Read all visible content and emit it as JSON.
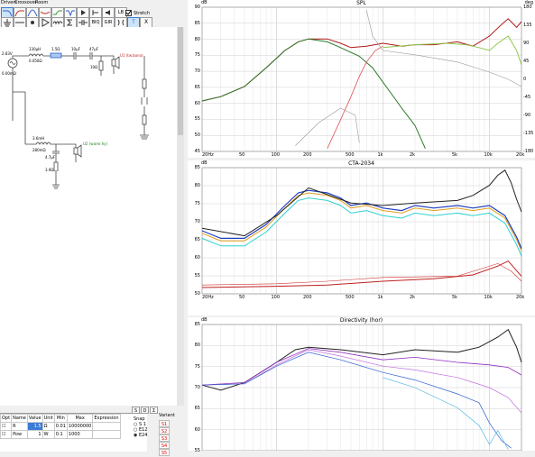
{
  "menu": {
    "drivers": "Drivers",
    "crossover": "Crossover",
    "room": "Room"
  },
  "toolbar": {
    "stretch_label": "Stretch",
    "lb": "LB",
    "biq": "BIQ",
    "gir": "GIR",
    "t": "T",
    "x": "X"
  },
  "schematic": {
    "source_v": "2.83V",
    "source_r": "0.00mΩ",
    "l1": "130µH",
    "l1_r": "0.050Ω",
    "r1": "1.5Ω",
    "c1": "10µF",
    "c2": "47µF",
    "r2": "10Ω",
    "tweeter_name": "U1 (tw.bono)",
    "l2": "3.6mH",
    "l2_r": "280mΩ",
    "c3": "4.7µF",
    "woofer_name": "U2 (warer.hy)",
    "r3": "3.9Ω"
  },
  "params": {
    "headers": [
      "Opt",
      "Name",
      "Value",
      "Unit",
      "Min",
      "Max",
      "Expression"
    ],
    "rows": [
      {
        "name": "R",
        "value": "1.5",
        "unit": "Ω",
        "min": "0.01",
        "max": "10000000"
      },
      {
        "name": "Pow",
        "value": "1",
        "unit": "W",
        "min": "0.1",
        "max": "1000"
      }
    ]
  },
  "snap": {
    "label": "Snap",
    "options": [
      "S 1",
      "E12",
      "E24"
    ],
    "selected": "E24"
  },
  "variant": {
    "label": "Variant",
    "items": [
      "S1",
      "S2",
      "S3",
      "S4",
      "S5"
    ]
  },
  "charts": [
    {
      "title": "SPL",
      "unit_left": "dB",
      "unit_right": "deg",
      "y_ticks": [
        "90",
        "85",
        "80",
        "75",
        "70",
        "65",
        "60",
        "55",
        "50",
        "45"
      ],
      "y_ticks_right": [
        "180",
        "135",
        "90",
        "45",
        "0",
        "-45",
        "-90",
        "-135",
        "-180"
      ],
      "x_ticks": [
        "20Hz",
        "50",
        "100",
        "200",
        "500",
        "1k",
        "2k",
        "5k",
        "10k",
        "20k"
      ],
      "colors": [
        "#2a7a2a",
        "#b01818",
        "#90c850",
        "#e05050",
        "#999999"
      ]
    },
    {
      "title": "CTA-2034",
      "unit_left": "dB",
      "y_ticks": [
        "85",
        "80",
        "75",
        "70",
        "65",
        "60",
        "55",
        "50"
      ],
      "x_ticks": [
        "20Hz",
        "50",
        "100",
        "200",
        "500",
        "1k",
        "2k",
        "5k",
        "10k",
        "20k"
      ],
      "colors": [
        "#222222",
        "#e0a020",
        "#d03030",
        "#2040c0",
        "#30d0d0",
        "#c02020"
      ]
    },
    {
      "title": "Directivity (hor)",
      "unit_left": "dB",
      "y_ticks": [
        "85",
        "80",
        "75",
        "70",
        "65",
        "60",
        "55"
      ],
      "x_ticks": [],
      "colors": [
        "#222222",
        "#9030c0",
        "#c070e0",
        "#3060d0",
        "#40b0e0"
      ]
    }
  ]
}
